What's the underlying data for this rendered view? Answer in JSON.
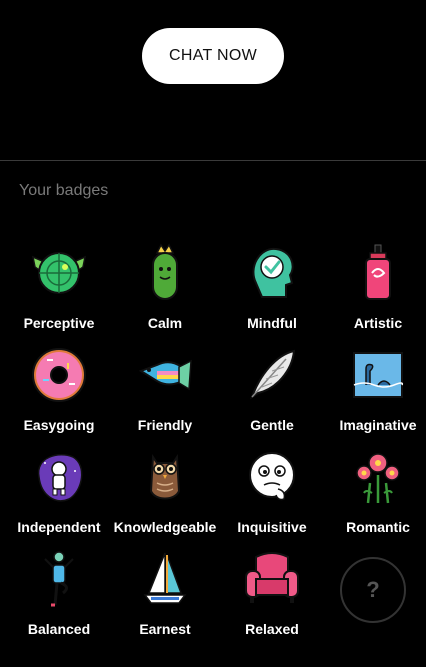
{
  "cta": {
    "label": "CHAT NOW"
  },
  "section": {
    "title": "Your badges"
  },
  "badges": [
    {
      "label": "Perceptive",
      "icon": "radar-target-icon"
    },
    {
      "label": "Calm",
      "icon": "pickle-crown-icon"
    },
    {
      "label": "Mindful",
      "icon": "head-check-icon"
    },
    {
      "label": "Artistic",
      "icon": "spray-can-icon"
    },
    {
      "label": "Easygoing",
      "icon": "donut-icon"
    },
    {
      "label": "Friendly",
      "icon": "fish-icon"
    },
    {
      "label": "Gentle",
      "icon": "feather-icon"
    },
    {
      "label": "Imaginative",
      "icon": "loch-ness-icon"
    },
    {
      "label": "Independent",
      "icon": "astronaut-icon"
    },
    {
      "label": "Knowledgeable",
      "icon": "owl-icon"
    },
    {
      "label": "Inquisitive",
      "icon": "thinking-face-icon"
    },
    {
      "label": "Romantic",
      "icon": "flowers-icon"
    },
    {
      "label": "Balanced",
      "icon": "yoga-pose-icon"
    },
    {
      "label": "Earnest",
      "icon": "sailboat-icon"
    },
    {
      "label": "Relaxed",
      "icon": "armchair-icon"
    }
  ],
  "locked_badge": {
    "label": "?"
  },
  "colors": {
    "background": "#000000",
    "button": "#ffffff",
    "muted_text": "#7a7a7a"
  }
}
